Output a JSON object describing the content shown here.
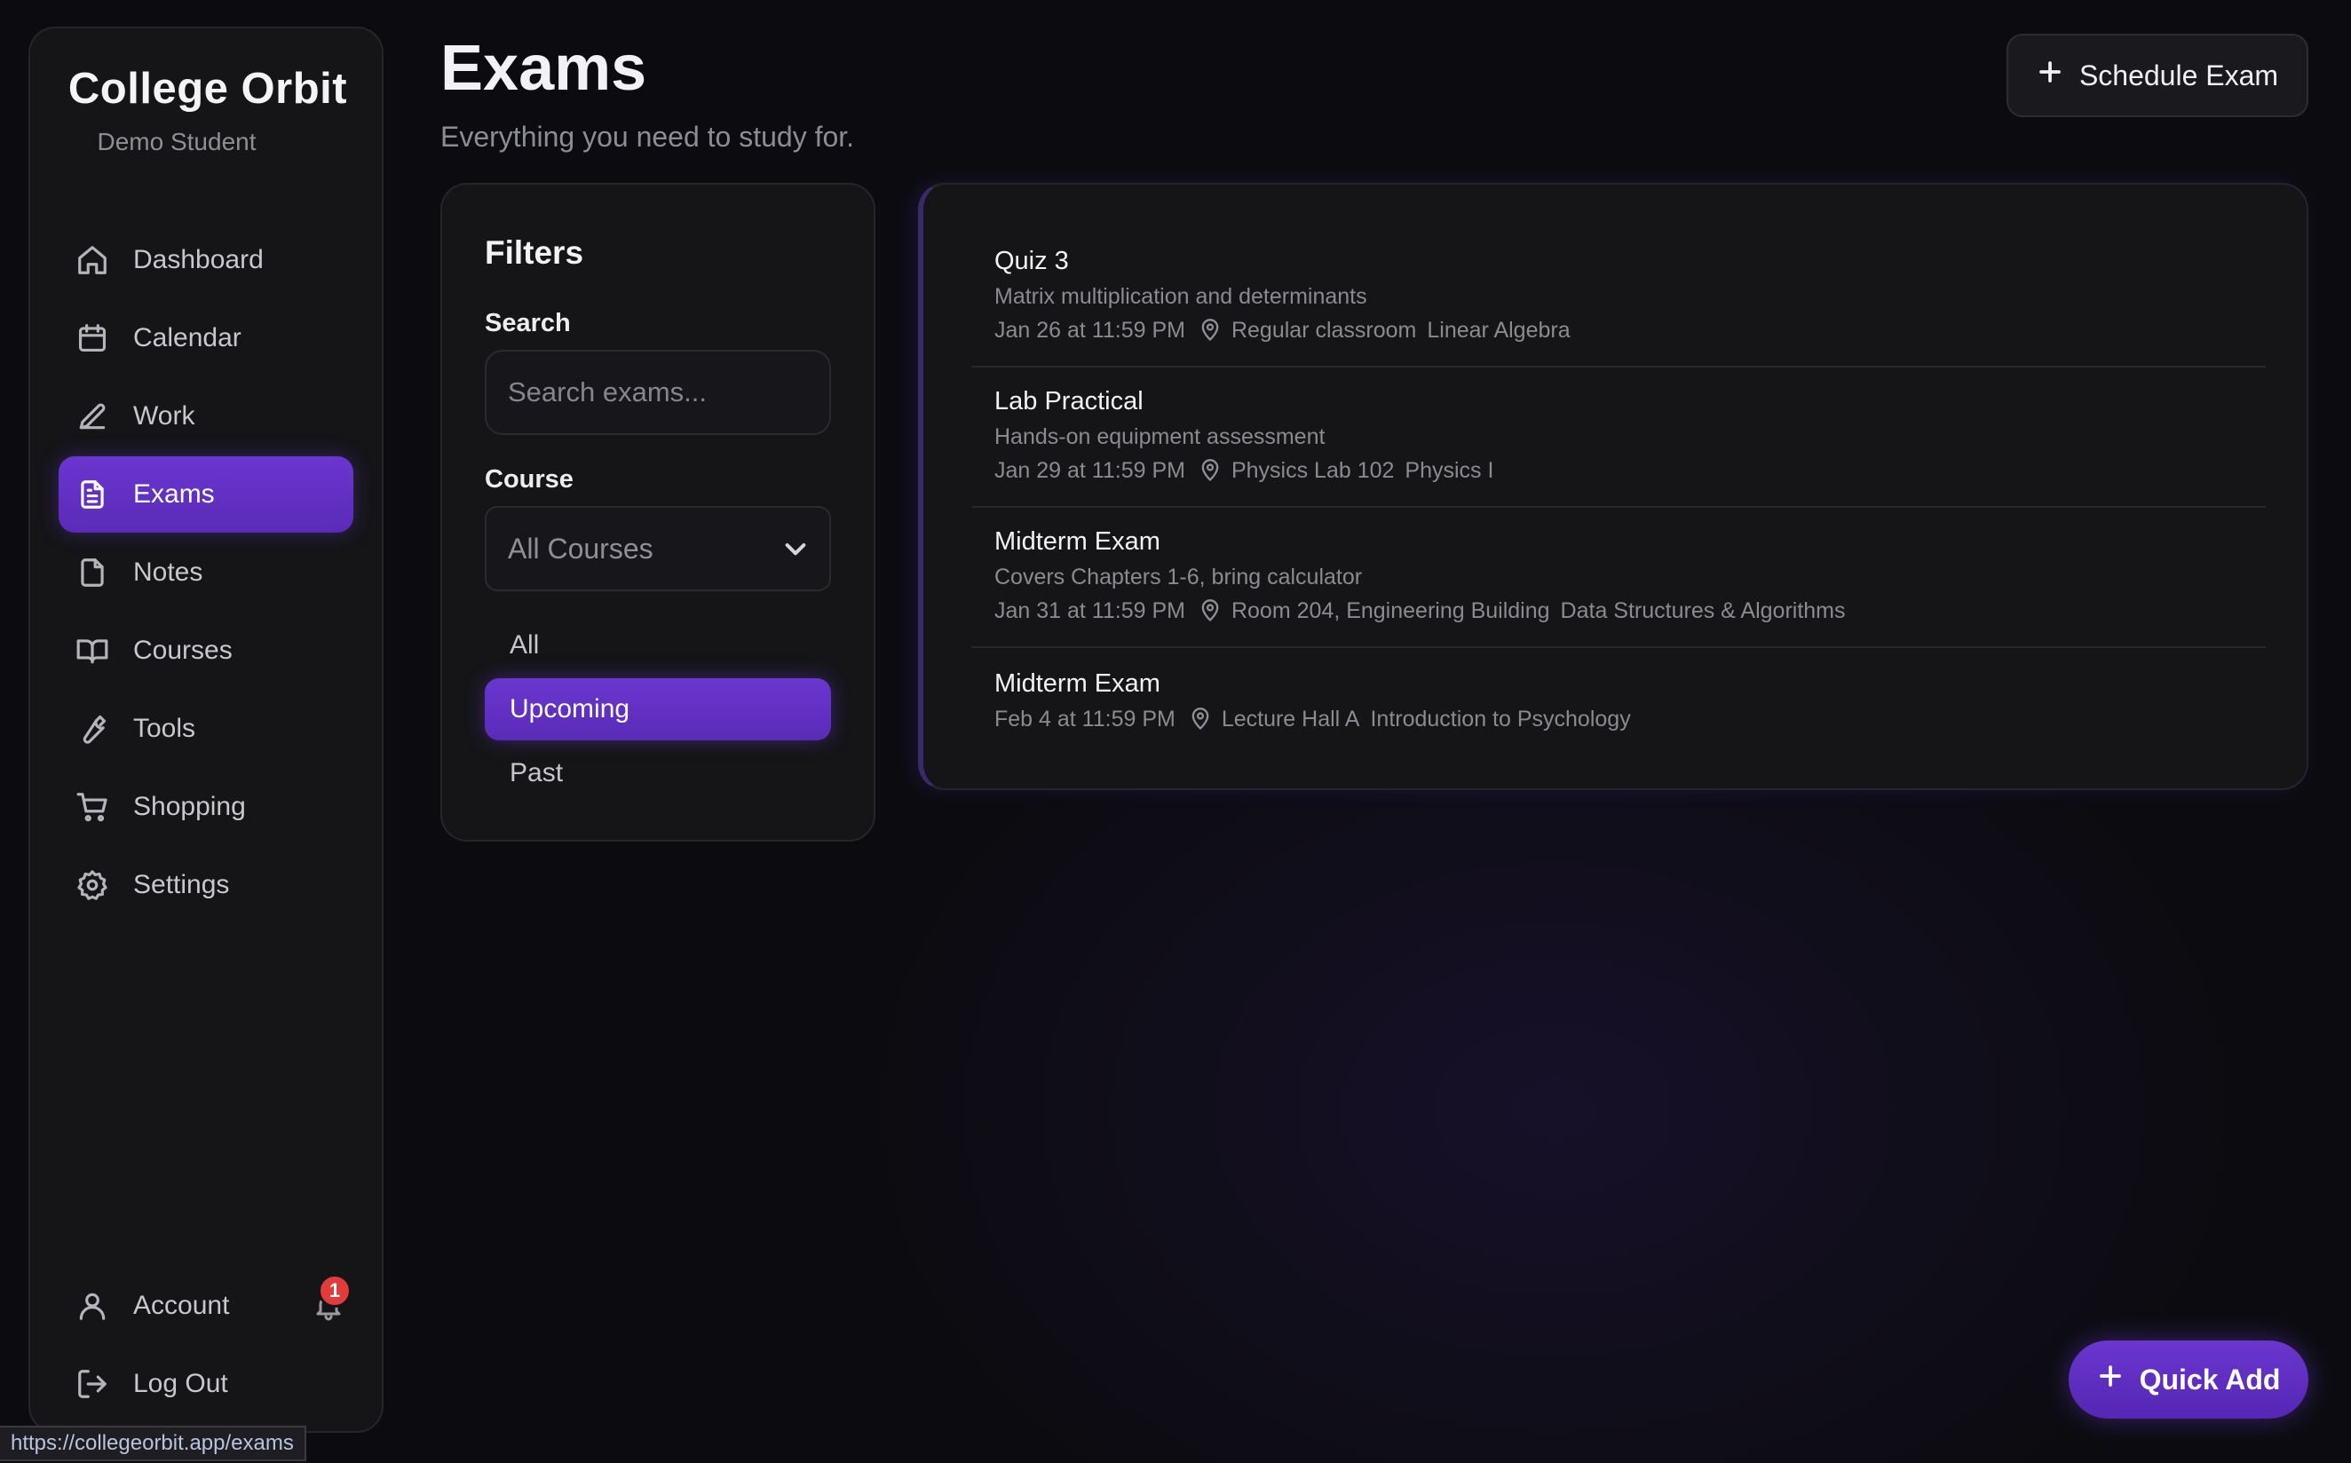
{
  "app": {
    "title": "College Orbit",
    "user": "Demo Student"
  },
  "sidebar": {
    "items": [
      {
        "label": "Dashboard",
        "icon": "home-icon"
      },
      {
        "label": "Calendar",
        "icon": "calendar-icon"
      },
      {
        "label": "Work",
        "icon": "pencil-icon"
      },
      {
        "label": "Exams",
        "icon": "document-icon",
        "active": true
      },
      {
        "label": "Notes",
        "icon": "note-icon"
      },
      {
        "label": "Courses",
        "icon": "book-icon"
      },
      {
        "label": "Tools",
        "icon": "wrench-icon"
      },
      {
        "label": "Shopping",
        "icon": "cart-icon"
      },
      {
        "label": "Settings",
        "icon": "gear-icon"
      }
    ],
    "account_label": "Account",
    "notification_count": "1",
    "logout_label": "Log Out"
  },
  "header": {
    "title": "Exams",
    "subtitle": "Everything you need to study for.",
    "schedule_label": "Schedule Exam"
  },
  "filters": {
    "title": "Filters",
    "search_label": "Search",
    "search_placeholder": "Search exams...",
    "search_value": "",
    "course_label": "Course",
    "course_selected": "All Courses",
    "segments": [
      "All",
      "Upcoming",
      "Past"
    ],
    "active_segment": "Upcoming"
  },
  "exams": [
    {
      "title": "Quiz 3",
      "description": "Matrix multiplication and determinants",
      "when": "Jan 26 at 11:59 PM",
      "location": "Regular classroom",
      "course": "Linear Algebra"
    },
    {
      "title": "Lab Practical",
      "description": "Hands-on equipment assessment",
      "when": "Jan 29 at 11:59 PM",
      "location": "Physics Lab 102",
      "course": "Physics I"
    },
    {
      "title": "Midterm Exam",
      "description": "Covers Chapters 1-6, bring calculator",
      "when": "Jan 31 at 11:59 PM",
      "location": "Room 204, Engineering Building",
      "course": "Data Structures & Algorithms"
    },
    {
      "title": "Midterm Exam",
      "description": "",
      "when": "Feb 4 at 11:59 PM",
      "location": "Lecture Hall A",
      "course": "Introduction to Psychology"
    }
  ],
  "quick_add_label": "Quick Add",
  "status_url": "https://collegeorbit.app/exams",
  "colors": {
    "accent": "#5f2fc2",
    "background": "#0c0c10",
    "panel": "#151518",
    "badge": "#e23b3b"
  }
}
